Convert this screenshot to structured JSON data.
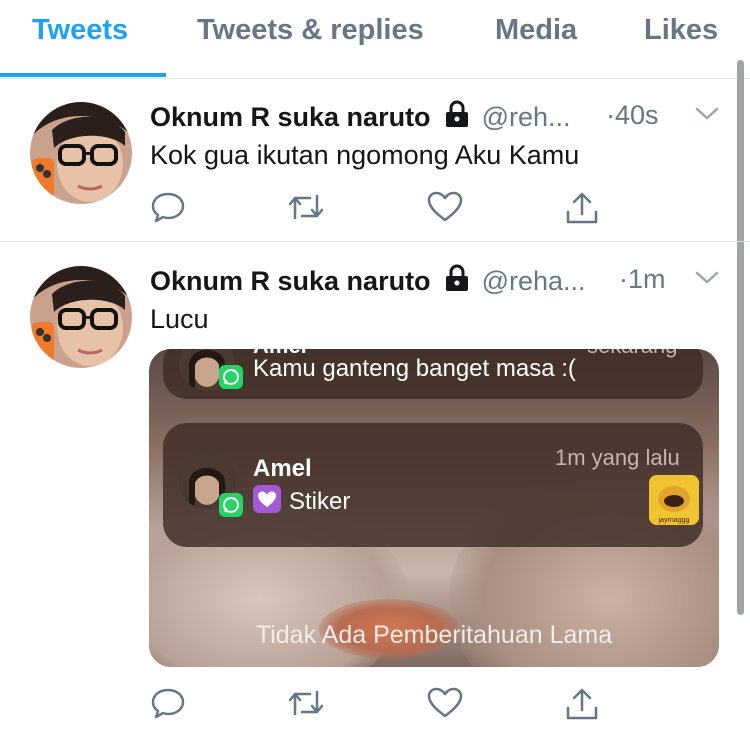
{
  "tabs": [
    {
      "label": "Tweets",
      "active": true
    },
    {
      "label": "Tweets & replies",
      "active": false
    },
    {
      "label": "Media",
      "active": false
    },
    {
      "label": "Likes",
      "active": false
    }
  ],
  "tweets": [
    {
      "name": "Oknum R suka naruto",
      "handle": "@reh...",
      "time": "·40s",
      "text": "Kok gua ikutan ngomong Aku Kamu"
    },
    {
      "name": "Oknum R suka naruto",
      "handle": "@reha...",
      "time": "·1m",
      "text": "Lucu",
      "media": {
        "notification_top": {
          "sender": "Amel",
          "time": "sekarang",
          "message": "Kamu ganteng banget masa :("
        },
        "notification_main": {
          "sender": "Amel",
          "time": "1m yang lalu",
          "message": "Stiker",
          "sticker_caption": "jayrnaggg"
        },
        "footer": "Tidak Ada Pemberitahuan Lama"
      }
    }
  ],
  "icons": {
    "lock": "lock-icon",
    "chevron": "chevron-down-icon",
    "reply": "reply-icon",
    "retweet": "retweet-icon",
    "like": "heart-icon",
    "share": "share-icon",
    "whatsapp": "whatsapp-icon"
  },
  "colors": {
    "accent": "#1da1f2",
    "secondary_text": "#657786",
    "divider": "#e1e8ed",
    "whatsapp": "#25d366"
  }
}
